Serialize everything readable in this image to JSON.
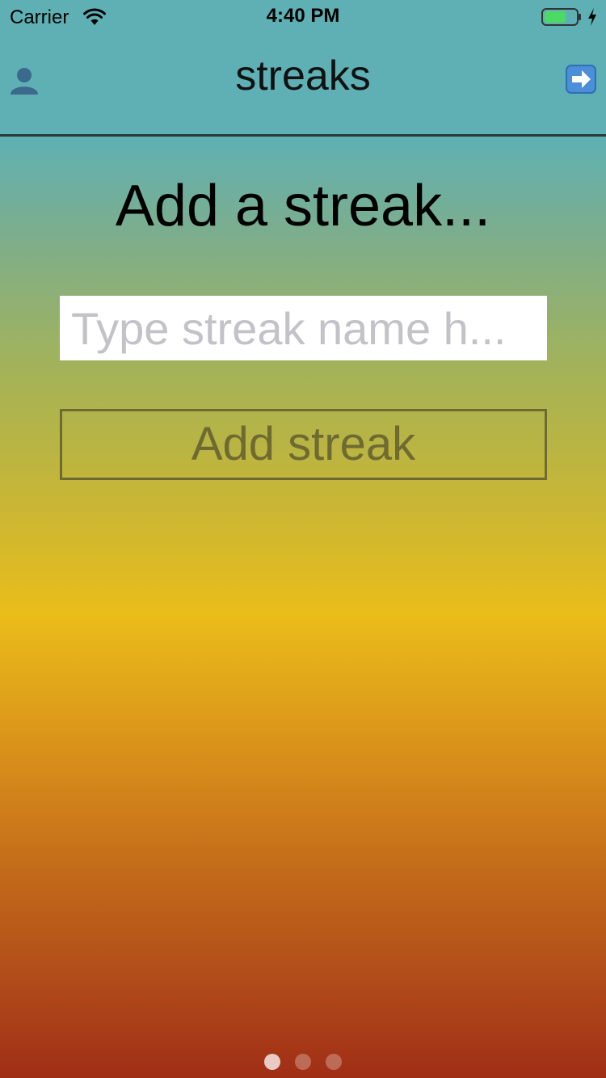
{
  "status_bar": {
    "carrier": "Carrier",
    "time": "4:40 PM",
    "battery_color": "#4cd964",
    "icons": [
      "wifi-icon",
      "battery-icon",
      "charging-bolt-icon"
    ]
  },
  "nav": {
    "title": "streaks",
    "left_icon": "profile-icon",
    "right_icon": "next-arrow-icon",
    "divider_color": "#2a3a3a"
  },
  "main": {
    "heading": "Add a streak...",
    "name_input": {
      "value": "",
      "placeholder": "Type streak name h..."
    },
    "add_button_label": "Add streak",
    "accent_color": "#6f6a32"
  },
  "page_indicator": {
    "count": 3,
    "active_index": 0
  },
  "colors": {
    "top": "#5eb0b4",
    "middle": "#eabd1a",
    "bottom": "#a02e16"
  }
}
